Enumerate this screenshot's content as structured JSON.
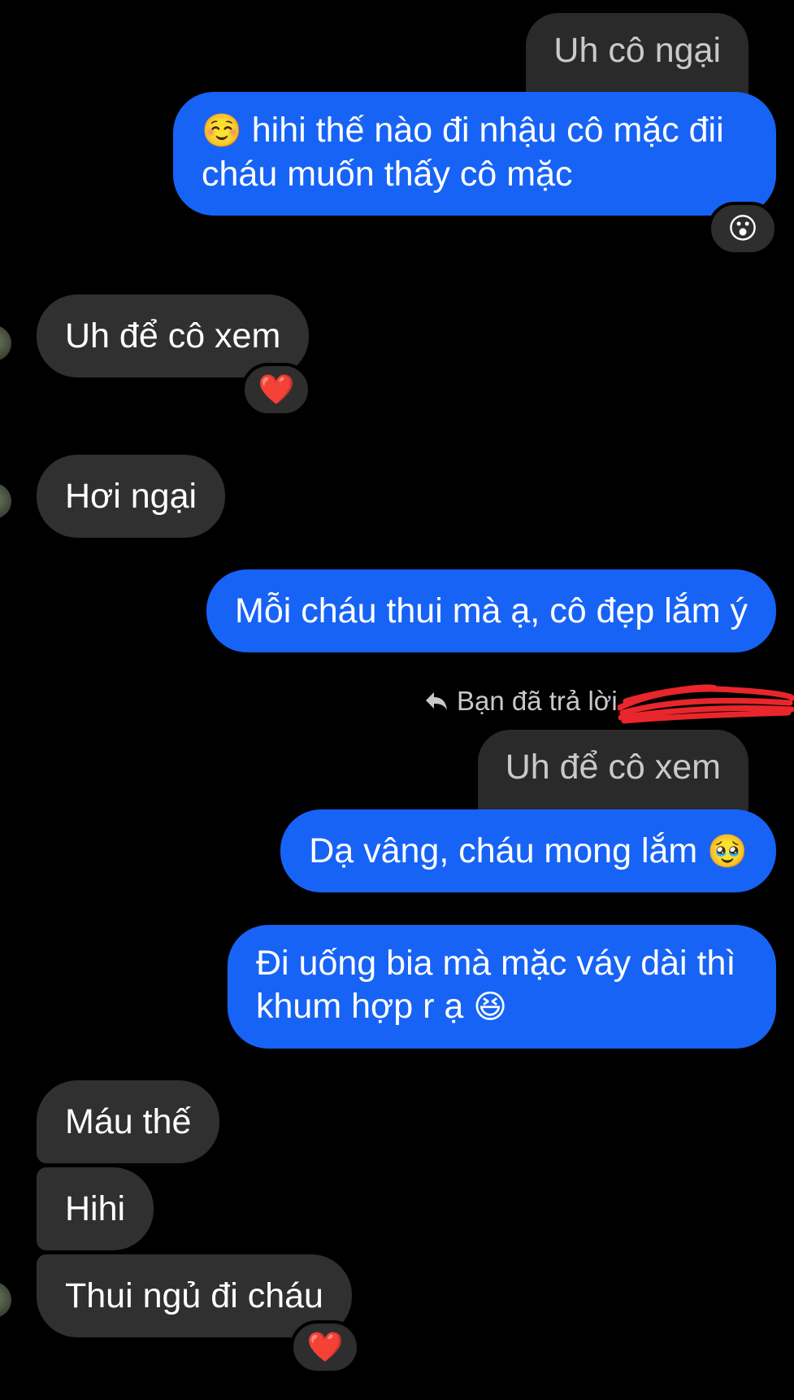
{
  "colors": {
    "background": "#000000",
    "outgoing_bubble": "#1763f6",
    "incoming_bubble": "#303030",
    "quote_bubble": "#2a2a2a",
    "redaction": "#e8262b"
  },
  "messages": {
    "quote_1": "Uh cô ngại",
    "out_1_emoji": "☺️",
    "out_1_line1": "hihi thế nào đi nhậu cô mặc đii",
    "out_1_line2": "cháu muốn thấy cô mặc",
    "out_1_reaction": "😮",
    "in_1": "Uh để cô xem",
    "in_1_reaction": "❤️",
    "in_2": "Hơi ngại",
    "out_2": "Mỗi cháu thui mà ạ, cô đẹp lắm ý",
    "reply_note": "Bạn đã trả lời",
    "reply_icon": "reply-arrow-icon",
    "quote_2": "Uh để cô xem",
    "out_3": "Dạ vâng, cháu mong lắm",
    "out_3_emoji": "🥹",
    "out_4_line1": "Đi uống bia mà mặc váy dài thì",
    "out_4_line2": "khum hợp r ạ",
    "out_4_emoji": "😆",
    "in_3": "Máu thế",
    "in_4": "Hihi",
    "in_5": "Thui ngủ đi cháu",
    "in_5_reaction": "❤️"
  }
}
